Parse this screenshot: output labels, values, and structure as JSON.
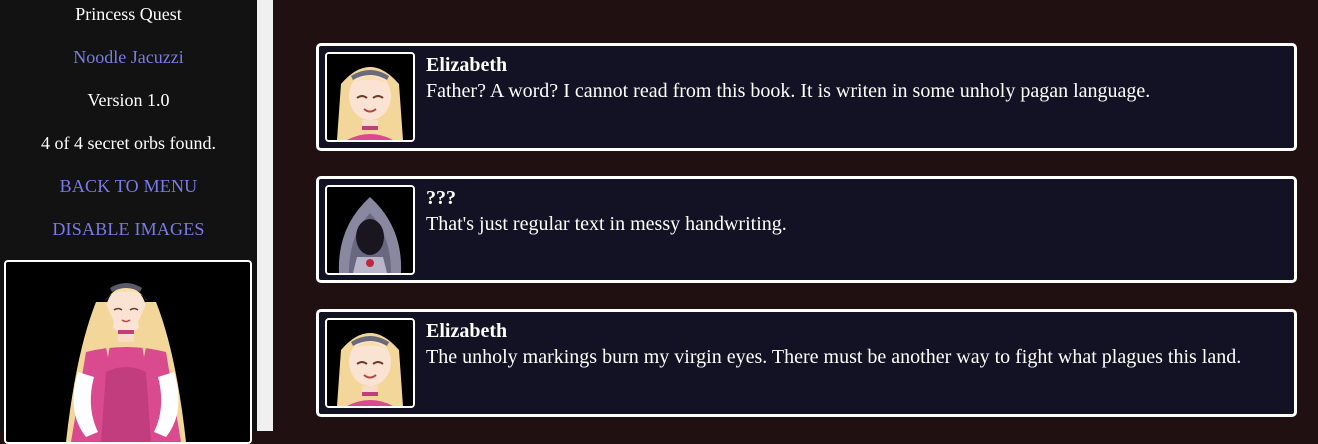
{
  "sidebar": {
    "game_title": "Princess Quest",
    "author": "Noodle Jacuzzi",
    "version": "Version 1.0",
    "orbs": "4 of 4 secret orbs found.",
    "back_to_menu": "BACK TO MENU",
    "disable_images": "DISABLE IMAGES"
  },
  "dialogue": [
    {
      "speaker": "Elizabeth",
      "text": "Father? A word? I cannot read from this book. It is writen in some unholy pagan language.",
      "avatar": "elizabeth-portrait"
    },
    {
      "speaker": "???",
      "text": "That's just regular text in messy handwriting.",
      "avatar": "hooded-figure-portrait"
    },
    {
      "speaker": "Elizabeth",
      "text": "The unholy markings burn my virgin eyes. There must be another way to fight what plagues this land.",
      "avatar": "elizabeth-portrait"
    }
  ],
  "colors": {
    "sidebar_bg": "#121212",
    "main_bg": "#211012",
    "dialogue_bg": "#131225",
    "link": "#7b7be6",
    "border": "#ffffff"
  }
}
